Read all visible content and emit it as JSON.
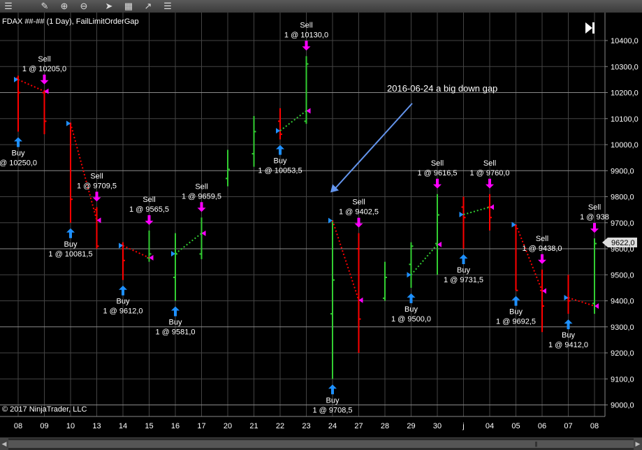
{
  "toolbar": {
    "icons": [
      "bar-style-icon",
      "pencil-icon",
      "zoom-in-icon",
      "zoom-out-icon",
      "pointer-icon",
      "data-box-icon",
      "drawing-tools-icon",
      "properties-icon"
    ]
  },
  "chart_data": {
    "type": "ohlc",
    "title": "FDAX ##-## (1 Day), FailLimitOrderGap",
    "copyright": "© 2017 NinjaTrader, LLC",
    "annotation": "2016-06-24 a big down gap",
    "current_price": "9622,0",
    "colors": {
      "up": "#32cd32",
      "down": "#ff0000",
      "entry": "#1e90ff",
      "exit": "#ff00ff",
      "arrow": "#6495ed",
      "grid": "#444444"
    },
    "x_labels": [
      "08",
      "09",
      "10",
      "13",
      "14",
      "15",
      "16",
      "17",
      "20",
      "21",
      "22",
      "23",
      "24",
      "27",
      "28",
      "29",
      "30",
      "j",
      "04",
      "05",
      "06",
      "07",
      "08"
    ],
    "y_ticks": [
      "9000,0",
      "9100,0",
      "9200,0",
      "9300,0",
      "9400,0",
      "9500,0",
      "9600,0",
      "9700,0",
      "9800,0",
      "9900,0",
      "10000,0",
      "10100,0",
      "10200,0",
      "10300,0",
      "10400,0"
    ],
    "ylim": [
      8990,
      10465
    ],
    "bars": [
      {
        "o": 10255,
        "h": 10265,
        "l": 10050,
        "c": 10200
      },
      {
        "o": 10200,
        "h": 10210,
        "l": 10040,
        "c": 10090
      },
      {
        "o": 10080,
        "h": 10085,
        "l": 9700,
        "c": 9790
      },
      {
        "o": 9750,
        "h": 9760,
        "l": 9600,
        "c": 9610
      },
      {
        "o": 9615,
        "h": 9625,
        "l": 9480,
        "c": 9555
      },
      {
        "o": 9565,
        "h": 9670,
        "l": 9550,
        "c": 9580
      },
      {
        "o": 9490,
        "h": 9660,
        "l": 9400,
        "c": 9580
      },
      {
        "o": 9580,
        "h": 9720,
        "l": 9560,
        "c": 9660
      },
      {
        "o": 9870,
        "h": 9980,
        "l": 9840,
        "c": 9905
      },
      {
        "o": 9965,
        "h": 10110,
        "l": 9915,
        "c": 10050
      },
      {
        "o": 10090,
        "h": 10140,
        "l": 10020,
        "c": 10040
      },
      {
        "o": 10090,
        "h": 10340,
        "l": 10080,
        "c": 10310
      },
      {
        "o": 9350,
        "h": 9710,
        "l": 9100,
        "c": 9480
      },
      {
        "o": 9600,
        "h": 9660,
        "l": 9200,
        "c": 9330
      },
      {
        "o": 9410,
        "h": 9550,
        "l": 9400,
        "c": 9490
      },
      {
        "o": 9540,
        "h": 9625,
        "l": 9450,
        "c": 9610
      },
      {
        "o": 9620,
        "h": 9810,
        "l": 9500,
        "c": 9730
      },
      {
        "o": 9760,
        "h": 9800,
        "l": 9600,
        "c": 9720
      },
      {
        "o": 9760,
        "h": 9810,
        "l": 9670,
        "c": 9720
      },
      {
        "o": 9690,
        "h": 9690,
        "l": 9440,
        "c": 9440
      },
      {
        "o": 9440,
        "h": 9520,
        "l": 9280,
        "c": 9380
      },
      {
        "o": 9410,
        "h": 9500,
        "l": 9350,
        "c": 9400
      },
      {
        "o": 9390,
        "h": 9640,
        "l": 9350,
        "c": 9620
      }
    ],
    "trades": [
      {
        "entry_bar": 0,
        "entry_price": 10250,
        "entry_text": [
          "Buy",
          "@ 10250,0"
        ],
        "exit_bar": 1,
        "exit_price": 10205,
        "exit_text": [
          "Sell",
          "1 @ 10205,0"
        ],
        "win": false
      },
      {
        "entry_bar": 2,
        "entry_price": 10081.5,
        "entry_text": [
          "Buy",
          "1 @ 10081,5"
        ],
        "exit_bar": 3,
        "exit_price": 9709.5,
        "exit_text": [
          "Sell",
          "1 @ 9709,5"
        ],
        "win": false
      },
      {
        "entry_bar": 4,
        "entry_price": 9612,
        "entry_text": [
          "Buy",
          "1 @ 9612,0"
        ],
        "exit_bar": 5,
        "exit_price": 9565.5,
        "exit_text": [
          "Sell",
          "1 @ 9565,5"
        ],
        "win": false
      },
      {
        "entry_bar": 6,
        "entry_price": 9581,
        "entry_text": [
          "Buy",
          "1 @ 9581,0"
        ],
        "exit_bar": 7,
        "exit_price": 9659.5,
        "exit_text": [
          "Sell",
          "1 @ 9659,5"
        ],
        "win": true
      },
      {
        "entry_bar": 10,
        "entry_price": 10053.5,
        "entry_text": [
          "Buy",
          "1 @ 10053,5"
        ],
        "exit_bar": 11,
        "exit_price": 10130,
        "exit_text": [
          "Sell",
          "1 @ 10130,0"
        ],
        "win": true
      },
      {
        "entry_bar": 12,
        "entry_price": 9708.5,
        "entry_text": [
          "Buy",
          "1 @ 9708,5"
        ],
        "exit_bar": 13,
        "exit_price": 9402.5,
        "exit_text": [
          "Sell",
          "1 @ 9402,5"
        ],
        "win": false
      },
      {
        "entry_bar": 15,
        "entry_price": 9500,
        "entry_text": [
          "Buy",
          "1 @ 9500,0"
        ],
        "exit_bar": 16,
        "exit_price": 9616.5,
        "exit_text": [
          "Sell",
          "1 @ 9616,5"
        ],
        "win": true
      },
      {
        "entry_bar": 17,
        "entry_price": 9731.5,
        "entry_text": [
          "Buy",
          "1 @ 9731,5"
        ],
        "exit_bar": 18,
        "exit_price": 9760,
        "exit_text": [
          "Sell",
          "1 @ 9760,0"
        ],
        "win": true
      },
      {
        "entry_bar": 19,
        "entry_price": 9692.5,
        "entry_text": [
          "Buy",
          "1 @ 9692,5"
        ],
        "exit_bar": 20,
        "exit_price": 9438,
        "exit_text": [
          "Sell",
          "1 @ 9438,0"
        ],
        "win": false
      },
      {
        "entry_bar": 21,
        "entry_price": 9412,
        "entry_text": [
          "Buy",
          "1 @ 9412,0"
        ],
        "exit_bar": 22,
        "exit_price": 9380,
        "exit_text": [
          "Sell",
          "1 @ 938"
        ],
        "win": false
      }
    ]
  }
}
